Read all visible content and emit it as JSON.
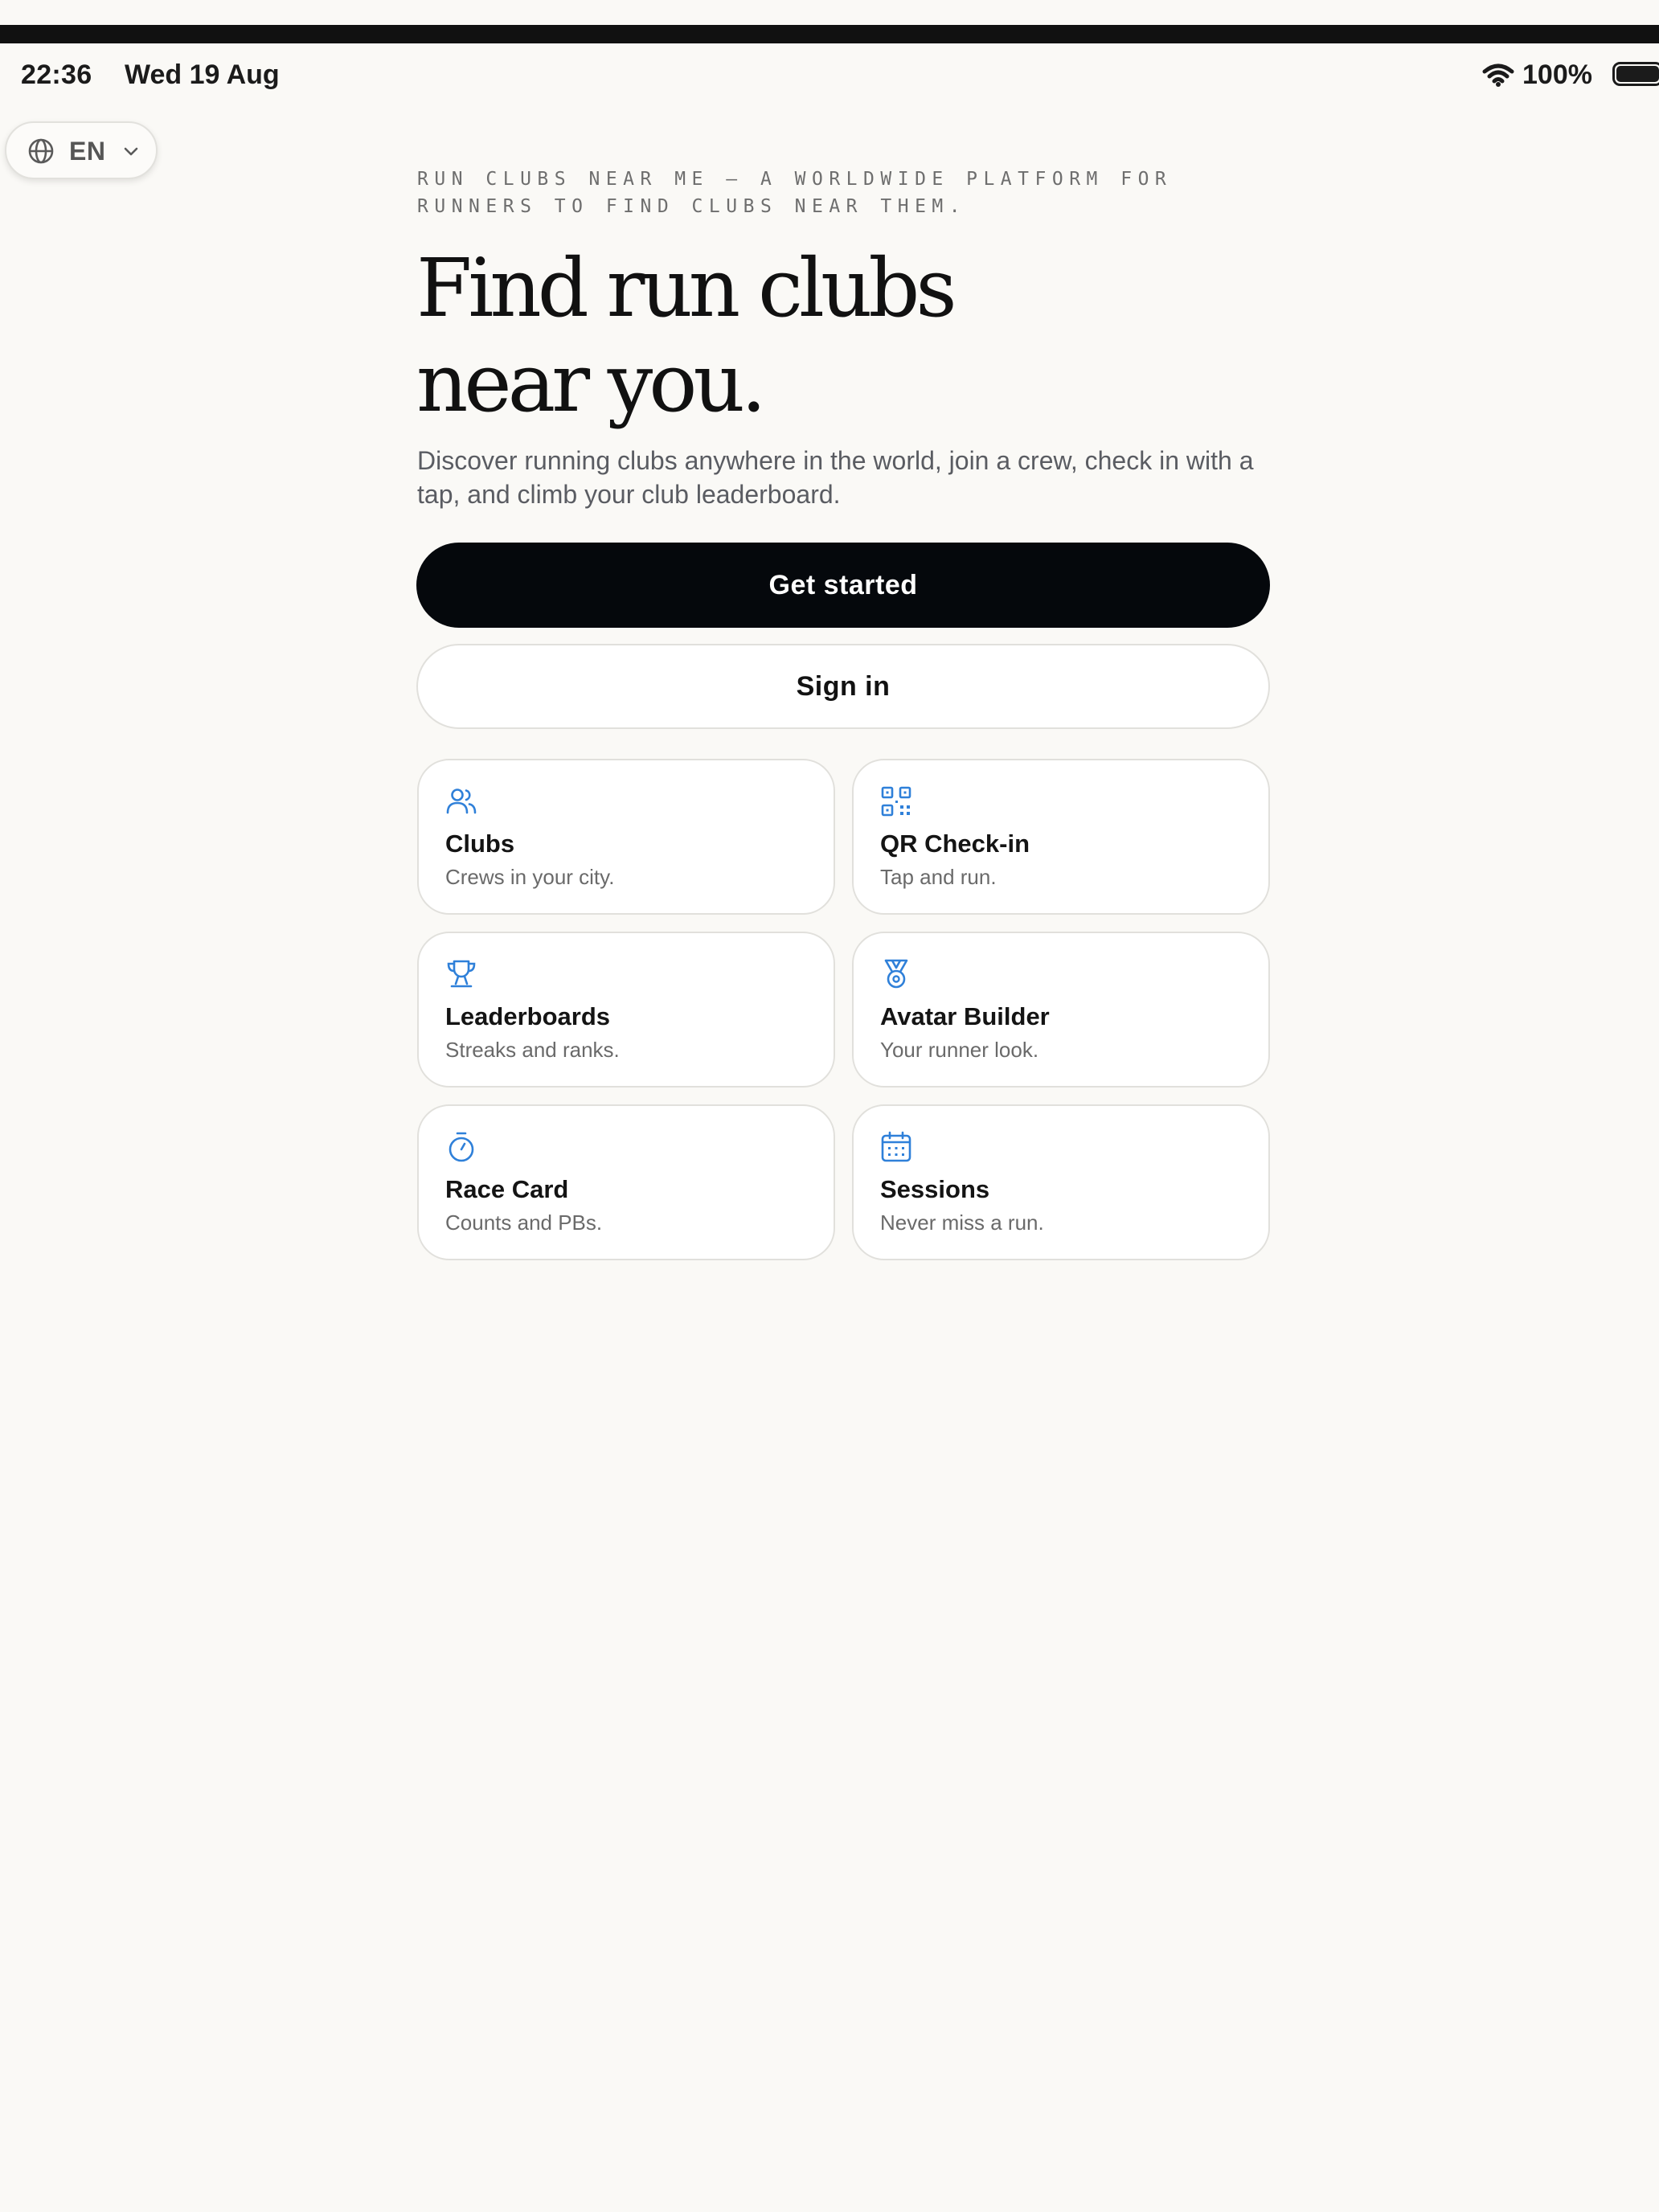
{
  "status_bar": {
    "time": "22:36",
    "date": "Wed 19 Aug",
    "battery_percent": "100%",
    "battery_level": 1.0,
    "wifi_icon": "wifi-icon",
    "battery_icon": "battery-icon"
  },
  "language": {
    "label": "EN",
    "icon": "globe-icon",
    "dropdown_icon": "chevron-down-icon"
  },
  "hero": {
    "eyebrow": "RUN CLUBS NEAR ME — A WORLDWIDE PLATFORM FOR RUNNERS TO FIND CLUBS NEAR THEM.",
    "headline_line1": "Find run clubs",
    "headline_line2": "near you.",
    "subtext": "Discover running clubs anywhere in the world, join a crew, check in with a tap, and climb your club leaderboard."
  },
  "actions": {
    "primary_label": "Get started",
    "secondary_label": "Sign in"
  },
  "features": [
    {
      "title": "Clubs",
      "desc": "Crews in your city.",
      "icon": "users-icon"
    },
    {
      "title": "QR Check-in",
      "desc": "Tap and run.",
      "icon": "qr-code-icon"
    },
    {
      "title": "Leaderboards",
      "desc": "Streaks and ranks.",
      "icon": "trophy-icon"
    },
    {
      "title": "Avatar Builder",
      "desc": "Your runner look.",
      "icon": "medal-icon"
    },
    {
      "title": "Race Card",
      "desc": "Counts and PBs.",
      "icon": "stopwatch-icon"
    },
    {
      "title": "Sessions",
      "desc": "Never miss a run.",
      "icon": "calendar-icon"
    }
  ],
  "colors": {
    "background": "#faf9f6",
    "accent_icon": "#2f80d9",
    "primary_button": "#05080c",
    "text_primary": "#111111",
    "text_secondary": "#6a6a6a"
  }
}
